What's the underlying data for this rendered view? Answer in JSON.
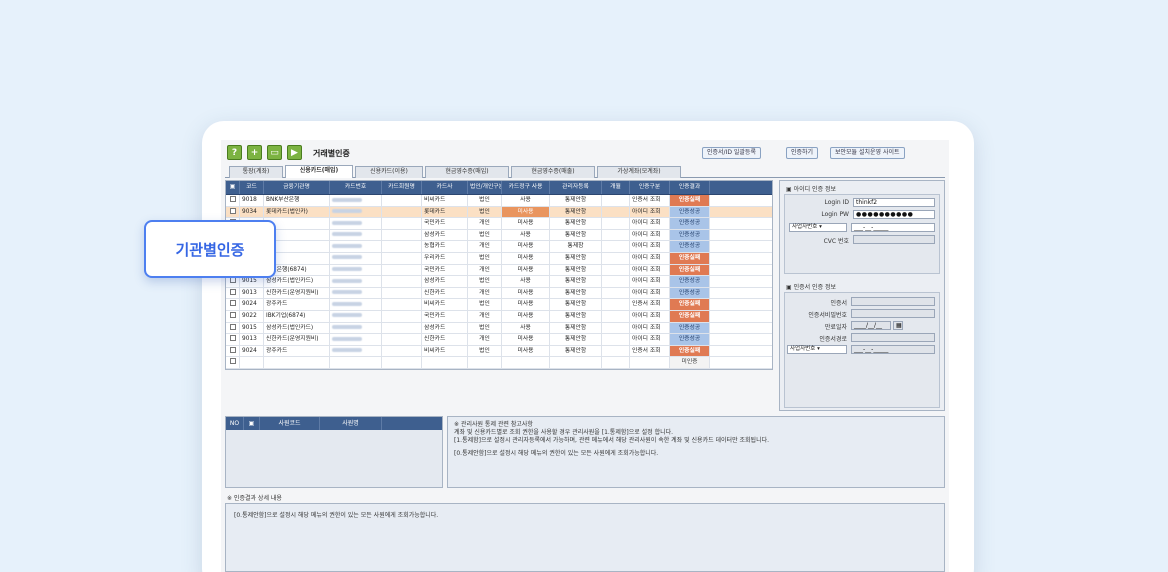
{
  "app": {
    "title": "거래별인증"
  },
  "top_buttons": [
    "인증서/ID 일괄등록",
    "인증하기",
    "보안모듈 설치운영 사이트"
  ],
  "toolbar_icons": [
    "help-icon",
    "add-icon",
    "window-icon",
    "play-icon"
  ],
  "toolbar_glyphs": [
    "?",
    "+",
    "▭",
    "▶"
  ],
  "tabs": [
    "통장(계좌)",
    "신용카드(매입)",
    "신용카드(이용)",
    "현금영수증(매입)",
    "현금영수증(매출)",
    "가상계좌(모계좌)"
  ],
  "callout": {
    "label": "기관별인증"
  },
  "grid": {
    "headers": [
      "",
      "코드",
      "금융기관명",
      "카드번호",
      "카드회원명",
      "카드사",
      "법인/개인구분",
      "카드정구 사용",
      "관리자등록",
      "개월",
      "인증구분",
      "인증결과"
    ],
    "rows": [
      {
        "code": "9018",
        "name": "BNK부산은행",
        "issuer": "비씨카드",
        "type": "법인",
        "use": "사용",
        "mgr": "통제안함",
        "auth": "인증서 조회",
        "result": "인증실패",
        "status": "fail",
        "highlight": false
      },
      {
        "code": "9034",
        "name": "롯데카드(법인카)",
        "issuer": "롯데카드",
        "type": "법인",
        "use": "미사용",
        "mgr": "통제안함",
        "auth": "아이디 조회",
        "result": "인증성공",
        "status": "ok",
        "highlight": true
      },
      {
        "code": "",
        "name": "",
        "issuer": "국민카드",
        "type": "개인",
        "use": "미사용",
        "mgr": "통제안함",
        "auth": "아이디 조회",
        "result": "인증성공",
        "status": "ok",
        "highlight": false
      },
      {
        "code": "",
        "name": "",
        "issuer": "삼성카드",
        "type": "법인",
        "use": "사용",
        "mgr": "통제안함",
        "auth": "아이디 조회",
        "result": "인증성공",
        "status": "ok",
        "highlight": false
      },
      {
        "code": "",
        "name": "",
        "issuer": "농협카드",
        "type": "개인",
        "use": "미사용",
        "mgr": "통제함",
        "auth": "아이디 조회",
        "result": "인증성공",
        "status": "ok",
        "highlight": false
      },
      {
        "code": "",
        "name": "",
        "issuer": "우리카드",
        "type": "법인",
        "use": "미사용",
        "mgr": "통제안함",
        "auth": "아이디 조회",
        "result": "인증실패",
        "status": "fail",
        "highlight": false
      },
      {
        "code": "9022",
        "name": "국민은행(6874)",
        "issuer": "국민카드",
        "type": "개인",
        "use": "미사용",
        "mgr": "통제안함",
        "auth": "아이디 조회",
        "result": "인증실패",
        "status": "fail",
        "highlight": false
      },
      {
        "code": "9015",
        "name": "삼성카드(법인카드)",
        "issuer": "삼성카드",
        "type": "법인",
        "use": "사용",
        "mgr": "통제안함",
        "auth": "아이디 조회",
        "result": "인증성공",
        "status": "ok",
        "highlight": false
      },
      {
        "code": "9013",
        "name": "신한카드(운영지원비)",
        "issuer": "신한카드",
        "type": "개인",
        "use": "미사용",
        "mgr": "통제안함",
        "auth": "아이디 조회",
        "result": "인증성공",
        "status": "ok",
        "highlight": false
      },
      {
        "code": "9024",
        "name": "광주카드",
        "issuer": "비씨카드",
        "type": "법인",
        "use": "미사용",
        "mgr": "통제안함",
        "auth": "인증서 조회",
        "result": "인증실패",
        "status": "fail",
        "highlight": false
      },
      {
        "code": "9022",
        "name": "IBK기업(6874)",
        "issuer": "국민카드",
        "type": "개인",
        "use": "미사용",
        "mgr": "통제안함",
        "auth": "아이디 조회",
        "result": "인증실패",
        "status": "fail",
        "highlight": false
      },
      {
        "code": "9015",
        "name": "삼성카드(법인카드)",
        "issuer": "삼성카드",
        "type": "법인",
        "use": "사용",
        "mgr": "통제안함",
        "auth": "아이디 조회",
        "result": "인증성공",
        "status": "ok",
        "highlight": false
      },
      {
        "code": "9013",
        "name": "신한카드(운영지원비)",
        "issuer": "신한카드",
        "type": "개인",
        "use": "미사용",
        "mgr": "통제안함",
        "auth": "아이디 조회",
        "result": "인증성공",
        "status": "ok",
        "highlight": false
      },
      {
        "code": "9024",
        "name": "광주카드",
        "issuer": "비씨카드",
        "type": "법인",
        "use": "미사용",
        "mgr": "통제안함",
        "auth": "인증서 조회",
        "result": "인증실패",
        "status": "fail",
        "highlight": false
      },
      {
        "code": "",
        "name": "",
        "issuer": "",
        "type": "",
        "use": "",
        "mgr": "",
        "auth": "",
        "result": "미인증",
        "status": "plain",
        "highlight": false
      }
    ]
  },
  "id_auth": {
    "title": "아이디 인증 정보",
    "login_id_label": "Login ID",
    "login_id_value": "thinkf2",
    "login_pw_label": "Login PW",
    "login_pw_value": "●●●●●●●●●●",
    "biz_select": "사업자번호",
    "biz_value": "___-__-_____",
    "cvc_label": "CVC 번호"
  },
  "cert_auth": {
    "title": "인증서 인증 정보",
    "cert_label": "인증서",
    "cert_pw_label": "인증서비밀번호",
    "expiry_label": "만료일자",
    "expiry_value": "____/__/__",
    "path_label": "인증서경로",
    "biz_select": "사업자번호",
    "biz_value": "___-__-_____"
  },
  "subgrid": {
    "headers": [
      "NO",
      "",
      "사원코드",
      "사원명"
    ]
  },
  "notice": {
    "lines": [
      "※ 관리사원 통제 관련 참고사항",
      "계좌 및 신용카드별로 조회 권한을 사용할 경우 관리사원을 [1.통제함]으로 설정 합니다.",
      "[1.통제함]으로 설정시 관리자등록에서 가능하며, 관련 메뉴에서 해당 관리사원이 속한 계좌 및 신용카드 데이터만 조회됩니다.",
      "[0.통제안함]으로 설정시 해당 메뉴의 권한이 있는 모든 사원에게 조회가능합니다."
    ]
  },
  "detail": {
    "title": "※ 인증결과 상세 내용",
    "text": "[0.통제안함]으로 설정시 해당 메뉴의 권한이 있는 모든 사원에게 조회가능합니다."
  },
  "colors": {
    "accent": "#3566e4",
    "header": "#3e5f8f",
    "fail": "#e07a53",
    "ok": "#a9c4e8",
    "highlight": "#fbe0c4",
    "toolbar_green": "#7cb342"
  }
}
